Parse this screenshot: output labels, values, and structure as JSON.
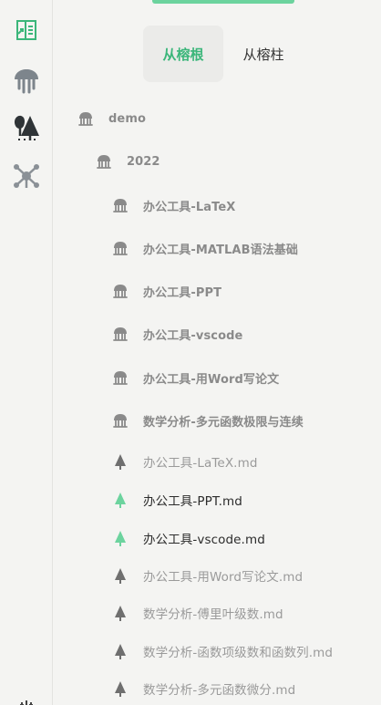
{
  "sidebar": {
    "buttons": [
      {
        "name": "outline-icon",
        "color": "#3bb67a"
      },
      {
        "name": "banyan-root-icon",
        "color": "#7d858c"
      },
      {
        "name": "banyan-trees-icon",
        "color": "#2f3437"
      },
      {
        "name": "graph-network-icon",
        "color": "#8a9096"
      },
      {
        "name": "settings-sliders-icon",
        "color": "#444"
      }
    ]
  },
  "tabs": [
    {
      "label": "从榕根",
      "active": true
    },
    {
      "label": "从榕柱",
      "active": false
    }
  ],
  "tree": [
    {
      "label": "demo",
      "type": "folder",
      "level": 0
    },
    {
      "label": "2022",
      "type": "folder",
      "level": 1
    },
    {
      "label": "办公工具-LaTeX",
      "type": "folder",
      "level": 2
    },
    {
      "label": "办公工具-MATLAB语法基础",
      "type": "folder",
      "level": 2
    },
    {
      "label": "办公工具-PPT",
      "type": "folder",
      "level": 2
    },
    {
      "label": "办公工具-vscode",
      "type": "folder",
      "level": 2
    },
    {
      "label": "办公工具-用Word写论文",
      "type": "folder",
      "level": 2
    },
    {
      "label": "数学分析-多元函数极限与连续",
      "type": "folder",
      "level": 2
    },
    {
      "label": "办公工具-LaTeX.md",
      "type": "file",
      "level": 2,
      "active": false
    },
    {
      "label": "办公工具-PPT.md",
      "type": "file",
      "level": 2,
      "active": true
    },
    {
      "label": "办公工具-vscode.md",
      "type": "file",
      "level": 2,
      "active": true
    },
    {
      "label": "办公工具-用Word写论文.md",
      "type": "file",
      "level": 2,
      "active": false
    },
    {
      "label": "数学分析-傅里叶级数.md",
      "type": "file",
      "level": 2,
      "active": false
    },
    {
      "label": "数学分析-函数项级数和函数列.md",
      "type": "file",
      "level": 2,
      "active": false
    },
    {
      "label": "数学分析-多元函数微分.md",
      "type": "file",
      "level": 2,
      "active": false
    }
  ],
  "colors": {
    "accent": "#3bb67a",
    "file_active_icon": "#6cd39e",
    "file_icon": "#6f6f6f",
    "folder_icon": "#8a8a8a"
  }
}
